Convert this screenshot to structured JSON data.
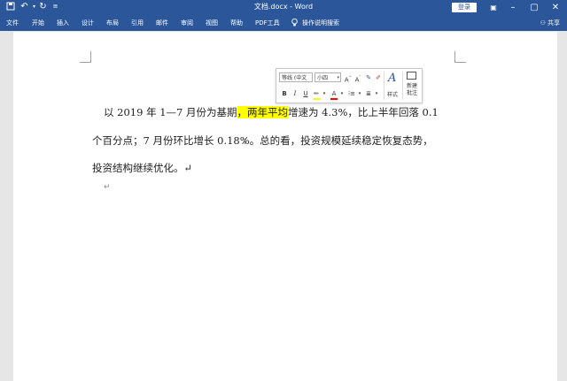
{
  "titlebar": {
    "doc_title": "文档.docx - Word",
    "login": "登录",
    "icons": [
      "save-icon",
      "undo-icon",
      "redo-icon",
      "customize-icon"
    ]
  },
  "menu": {
    "items": [
      "文件",
      "开始",
      "插入",
      "设计",
      "布局",
      "引用",
      "邮件",
      "审阅",
      "视图",
      "帮助",
      "PDF工具",
      "操作说明搜索"
    ],
    "share": "共享"
  },
  "document": {
    "line1_before": "以 2019 年 1—7 月份为基期",
    "line1_highlight": "，两年平均",
    "line1_after": "增速为 4.3%，比上半年回落 0.1",
    "line2": "个百分点；7 月份环比增长 0.18%。总的看，投资规模延续稳定恢复态势，",
    "line3": "投资结构继续优化。↵",
    "empty_para": "↵"
  },
  "mini_toolbar": {
    "font": "等线 (中文",
    "size": "小四",
    "bold": "B",
    "italic": "I",
    "underline": "U",
    "styles_label": "样式",
    "new_comment_line1": "新建",
    "new_comment_line2": "批注"
  },
  "colors": {
    "accent": "#2b579a",
    "highlight": "#ffff00",
    "font_color": "#ff0000"
  }
}
